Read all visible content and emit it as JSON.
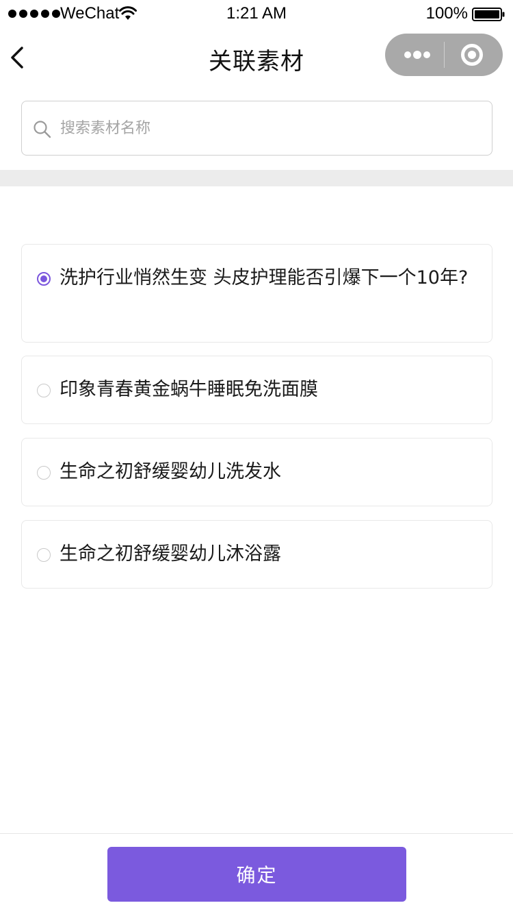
{
  "status_bar": {
    "carrier": "WeChat",
    "time": "1:21 AM",
    "battery_percent": "100%",
    "icons": [
      "signal-icon",
      "wifi-icon",
      "battery-icon"
    ]
  },
  "nav": {
    "title": "关联素材",
    "icons": [
      "back-arrow-icon",
      "more-dots-icon",
      "close-circle-icon"
    ]
  },
  "search": {
    "placeholder": "搜索素材名称",
    "value": "",
    "icon": "search-icon"
  },
  "options": [
    {
      "label": "洗护行业悄然生变 头皮护理能否引爆下一个10年?",
      "selected": true
    },
    {
      "label": "印象青春黄金蜗牛睡眠免洗面膜",
      "selected": false
    },
    {
      "label": "生命之初舒缓婴幼儿洗发水",
      "selected": false
    },
    {
      "label": "生命之初舒缓婴幼儿沐浴露",
      "selected": false
    }
  ],
  "footer": {
    "confirm_label": "确定"
  },
  "colors": {
    "accent": "#7b5ade",
    "capsule": "#a9a9a9",
    "band": "#ececec"
  }
}
